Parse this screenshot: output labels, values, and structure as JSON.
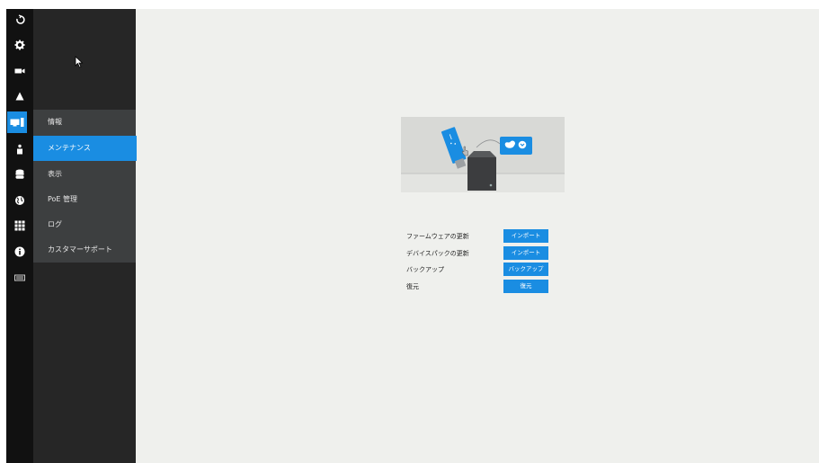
{
  "iconbar": {
    "items": [
      {
        "icon": "logout-icon"
      },
      {
        "icon": "gear-icon"
      },
      {
        "icon": "camera-icon"
      },
      {
        "icon": "alert-icon"
      },
      {
        "icon": "system-icon",
        "active": true
      },
      {
        "icon": "user-icon"
      },
      {
        "icon": "storage-icon"
      },
      {
        "icon": "network-icon"
      },
      {
        "icon": "apps-grid-icon"
      },
      {
        "icon": "info-icon"
      },
      {
        "icon": "device-icon"
      }
    ]
  },
  "submenu": {
    "items": [
      {
        "label": "情報"
      },
      {
        "label": "メンテナンス",
        "active": true
      },
      {
        "label": "表示"
      },
      {
        "label": "PoE 管理"
      },
      {
        "label": "ログ"
      },
      {
        "label": "カスタマーサポート"
      }
    ]
  },
  "maintenance": {
    "rows": [
      {
        "label": "ファームウェアの更新",
        "button": "インポート"
      },
      {
        "label": "デバイスパックの更新",
        "button": "インポート"
      },
      {
        "label": "バックアップ",
        "button": "バックアップ"
      },
      {
        "label": "復元",
        "button": "復元"
      }
    ]
  },
  "colors": {
    "accent": "#1a8de2",
    "sidebar": "#111111",
    "submenu": "#262626",
    "submenu_group": "#3d3f40",
    "content_bg": "#eff0ed"
  }
}
